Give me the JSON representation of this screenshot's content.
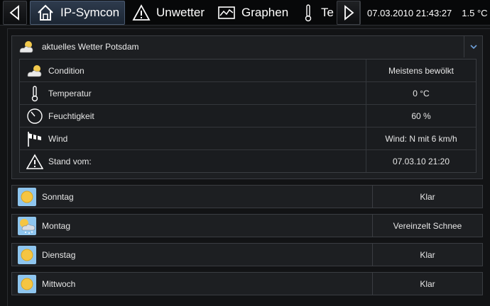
{
  "topbar": {
    "tabs": [
      {
        "label": "IP-Symcon",
        "icon": "home-icon",
        "active": true
      },
      {
        "label": "Unwetter",
        "icon": "warning-icon",
        "active": false
      },
      {
        "label": "Graphen",
        "icon": "chart-icon",
        "active": false
      },
      {
        "label": "Te",
        "icon": "thermometer-icon",
        "active": false
      }
    ],
    "datetime": "07.03.2010 21:43:27",
    "temperature": "1.5 °C"
  },
  "weather": {
    "title": "aktuelles Wetter Potsdam",
    "rows": [
      {
        "label": "Condition",
        "icon": "cloud-sun-icon",
        "value": "Meistens bewölkt"
      },
      {
        "label": "Temperatur",
        "icon": "thermometer-icon",
        "value": "0 °C"
      },
      {
        "label": "Feuchtigkeit",
        "icon": "gauge-icon",
        "value": "60 %"
      },
      {
        "label": "Wind",
        "icon": "windsock-icon",
        "value": "Wind: N mit 6 km/h"
      },
      {
        "label": "Stand vom:",
        "icon": "warning-icon",
        "value": "07.03.10 21:20"
      }
    ]
  },
  "forecast": [
    {
      "day": "Sonntag",
      "icon": "sun-icon",
      "value": "Klar"
    },
    {
      "day": "Montag",
      "icon": "snow-cloud-icon",
      "value": "Vereinzelt Schnee"
    },
    {
      "day": "Dienstag",
      "icon": "sun-icon",
      "value": "Klar"
    },
    {
      "day": "Mittwoch",
      "icon": "sun-icon",
      "value": "Klar"
    }
  ],
  "colors": {
    "background": "#121315",
    "panel": "#1d1f22",
    "border": "#3a3d42",
    "active_tab": "#2e3b4d"
  }
}
